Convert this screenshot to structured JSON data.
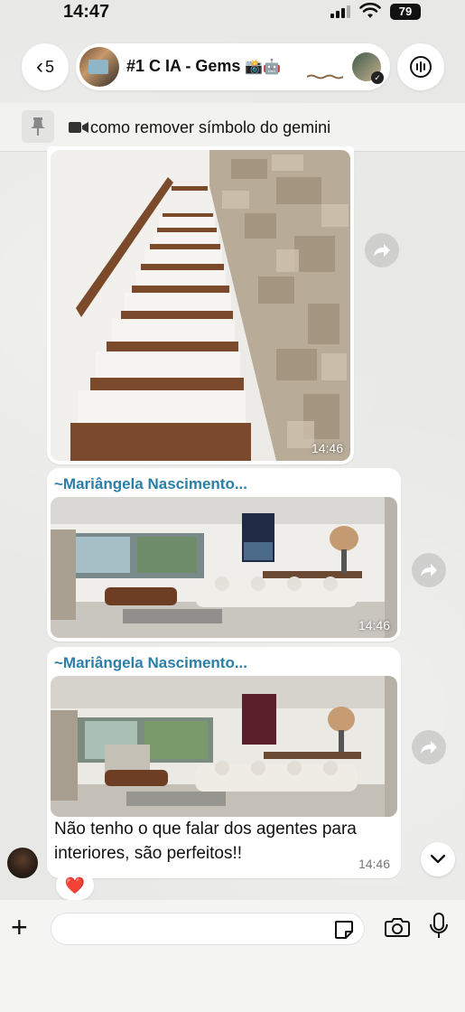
{
  "status": {
    "time": "14:47",
    "battery": "79"
  },
  "header": {
    "back_count": "5",
    "group_title": "#1 C IA - Gems",
    "title_emojis": "📸🤖"
  },
  "pinned": {
    "text": "como remover símbolo do gemini"
  },
  "messages": [
    {
      "type": "image",
      "alt": "staircase",
      "time": "14:46"
    },
    {
      "type": "image",
      "sender": "~Mariângela Nascimento...",
      "time": "14:46"
    },
    {
      "type": "image_text",
      "sender": "~Mariângela Nascimento...",
      "text": "Não tenho o que falar dos agentes para interiores, são perfeitos!!",
      "time": "14:46",
      "reaction": "❤️"
    }
  ],
  "composer": {
    "placeholder": ""
  },
  "colors": {
    "sender": "#2a7fa8",
    "background": "#e8e8e6"
  }
}
